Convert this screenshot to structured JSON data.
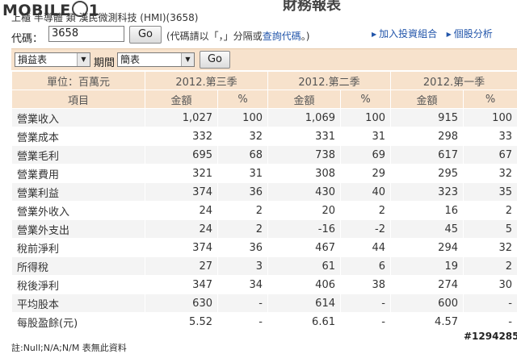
{
  "watermark": {
    "brand": "MOBILE01"
  },
  "header": {
    "page_title": "財務報表",
    "stock_line": "上櫃 半導體 類 漢民微測科技 (HMI)(3658)",
    "code_label": "代碼：",
    "code_value": "3658",
    "go_label": "Go",
    "hint_prefix": "(代碼請以「，」分隔或",
    "hint_link": "查詢代碼",
    "hint_suffix": "。)",
    "links": [
      {
        "label": "加入投資組合",
        "icon": "triangle-right-icon"
      },
      {
        "label": "個股分析",
        "icon": "triangle-right-icon"
      }
    ]
  },
  "filters": {
    "report_select": "損益表",
    "period_label": "期間",
    "period_select": "簡表",
    "go_label": "Go"
  },
  "table": {
    "unit_label": "單位：百萬元",
    "item_header": "項目",
    "periods": [
      "2012.第三季",
      "2012.第二季",
      "2012.第一季"
    ],
    "amount_header": "金額",
    "pct_header": "%",
    "rows": [
      {
        "item": "營業收入",
        "q3": "1,027",
        "q3p": "100",
        "q2": "1,069",
        "q2p": "100",
        "q1": "915",
        "q1p": "100"
      },
      {
        "item": "營業成本",
        "q3": "332",
        "q3p": "32",
        "q2": "331",
        "q2p": "31",
        "q1": "298",
        "q1p": "33"
      },
      {
        "item": "營業毛利",
        "q3": "695",
        "q3p": "68",
        "q2": "738",
        "q2p": "69",
        "q1": "617",
        "q1p": "67"
      },
      {
        "item": "營業費用",
        "q3": "321",
        "q3p": "31",
        "q2": "308",
        "q2p": "29",
        "q1": "295",
        "q1p": "32"
      },
      {
        "item": "營業利益",
        "q3": "374",
        "q3p": "36",
        "q2": "430",
        "q2p": "40",
        "q1": "323",
        "q1p": "35"
      },
      {
        "item": "營業外收入",
        "q3": "24",
        "q3p": "2",
        "q2": "20",
        "q2p": "2",
        "q1": "16",
        "q1p": "2"
      },
      {
        "item": "營業外支出",
        "q3": "24",
        "q3p": "2",
        "q2": "-16",
        "q2p": "-2",
        "q1": "45",
        "q1p": "5"
      },
      {
        "item": "稅前淨利",
        "q3": "374",
        "q3p": "36",
        "q2": "467",
        "q2p": "44",
        "q1": "294",
        "q1p": "32"
      },
      {
        "item": "所得稅",
        "q3": "27",
        "q3p": "3",
        "q2": "61",
        "q2p": "6",
        "q1": "19",
        "q1p": "2"
      },
      {
        "item": "稅後淨利",
        "q3": "347",
        "q3p": "34",
        "q2": "406",
        "q2p": "38",
        "q1": "274",
        "q1p": "30"
      },
      {
        "item": "平均股本",
        "q3": "630",
        "q3p": "-",
        "q2": "614",
        "q2p": "-",
        "q1": "600",
        "q1p": "-"
      },
      {
        "item": "每股盈餘(元)",
        "q3": "5.52",
        "q3p": "-",
        "q2": "6.61",
        "q2p": "-",
        "q1": "4.57",
        "q1p": "-"
      }
    ]
  },
  "footnote": "註:Null;N/A;N/M 表無此資料",
  "image_tag": "#1294285",
  "colors": {
    "header_bg": "#f7e2cc",
    "link": "#2255aa",
    "row_alt": "#f4f4f4"
  }
}
